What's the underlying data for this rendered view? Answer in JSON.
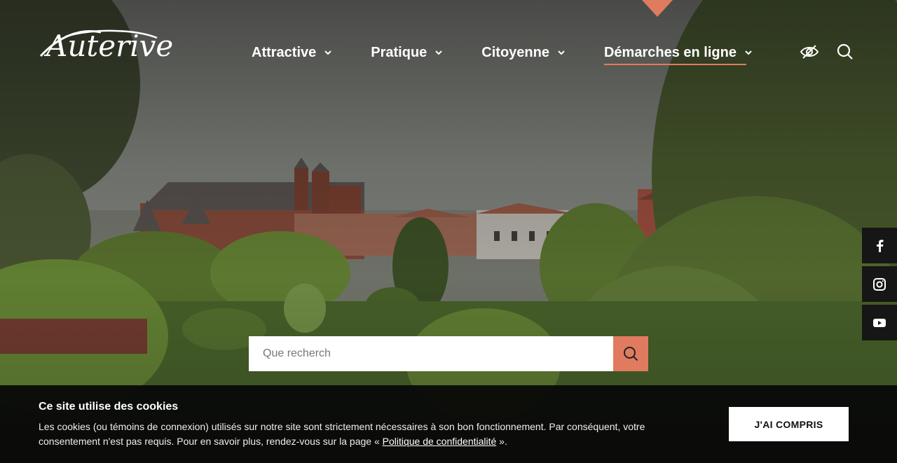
{
  "brand": {
    "logo_text": "Auterive",
    "accent_color": "#e07b5f"
  },
  "nav": {
    "items": [
      {
        "label": "Attractive",
        "icon": "chevron-down-icon"
      },
      {
        "label": "Pratique",
        "icon": "chevron-down-icon"
      },
      {
        "label": "Citoyenne",
        "icon": "chevron-down-icon"
      },
      {
        "label": "Démarches en ligne",
        "icon": "chevron-down-icon",
        "active": true
      }
    ]
  },
  "tools": {
    "accessibility_icon": "eye-off-icon",
    "search_icon": "search-icon"
  },
  "social": [
    {
      "network": "facebook",
      "icon": "facebook-icon"
    },
    {
      "network": "instagram",
      "icon": "instagram-icon"
    },
    {
      "network": "youtube",
      "icon": "youtube-icon"
    }
  ],
  "search": {
    "placeholder": "Que recherch",
    "button_icon": "search-icon"
  },
  "cookie": {
    "title": "Ce site utilise des cookies",
    "text_line1": "Les cookies (ou témoins de connexion) utilisés sur notre site sont strictement nécessaires à son bon fonctionnement. Par conséquent, votre",
    "text_line2_prefix": "consentement n'est pas requis. Pour en savoir plus, rendez-vous sur la page « ",
    "link_label": "Politique de confidentialité",
    "text_line2_suffix": " ».",
    "accept_label": "J'AI COMPRIS"
  }
}
